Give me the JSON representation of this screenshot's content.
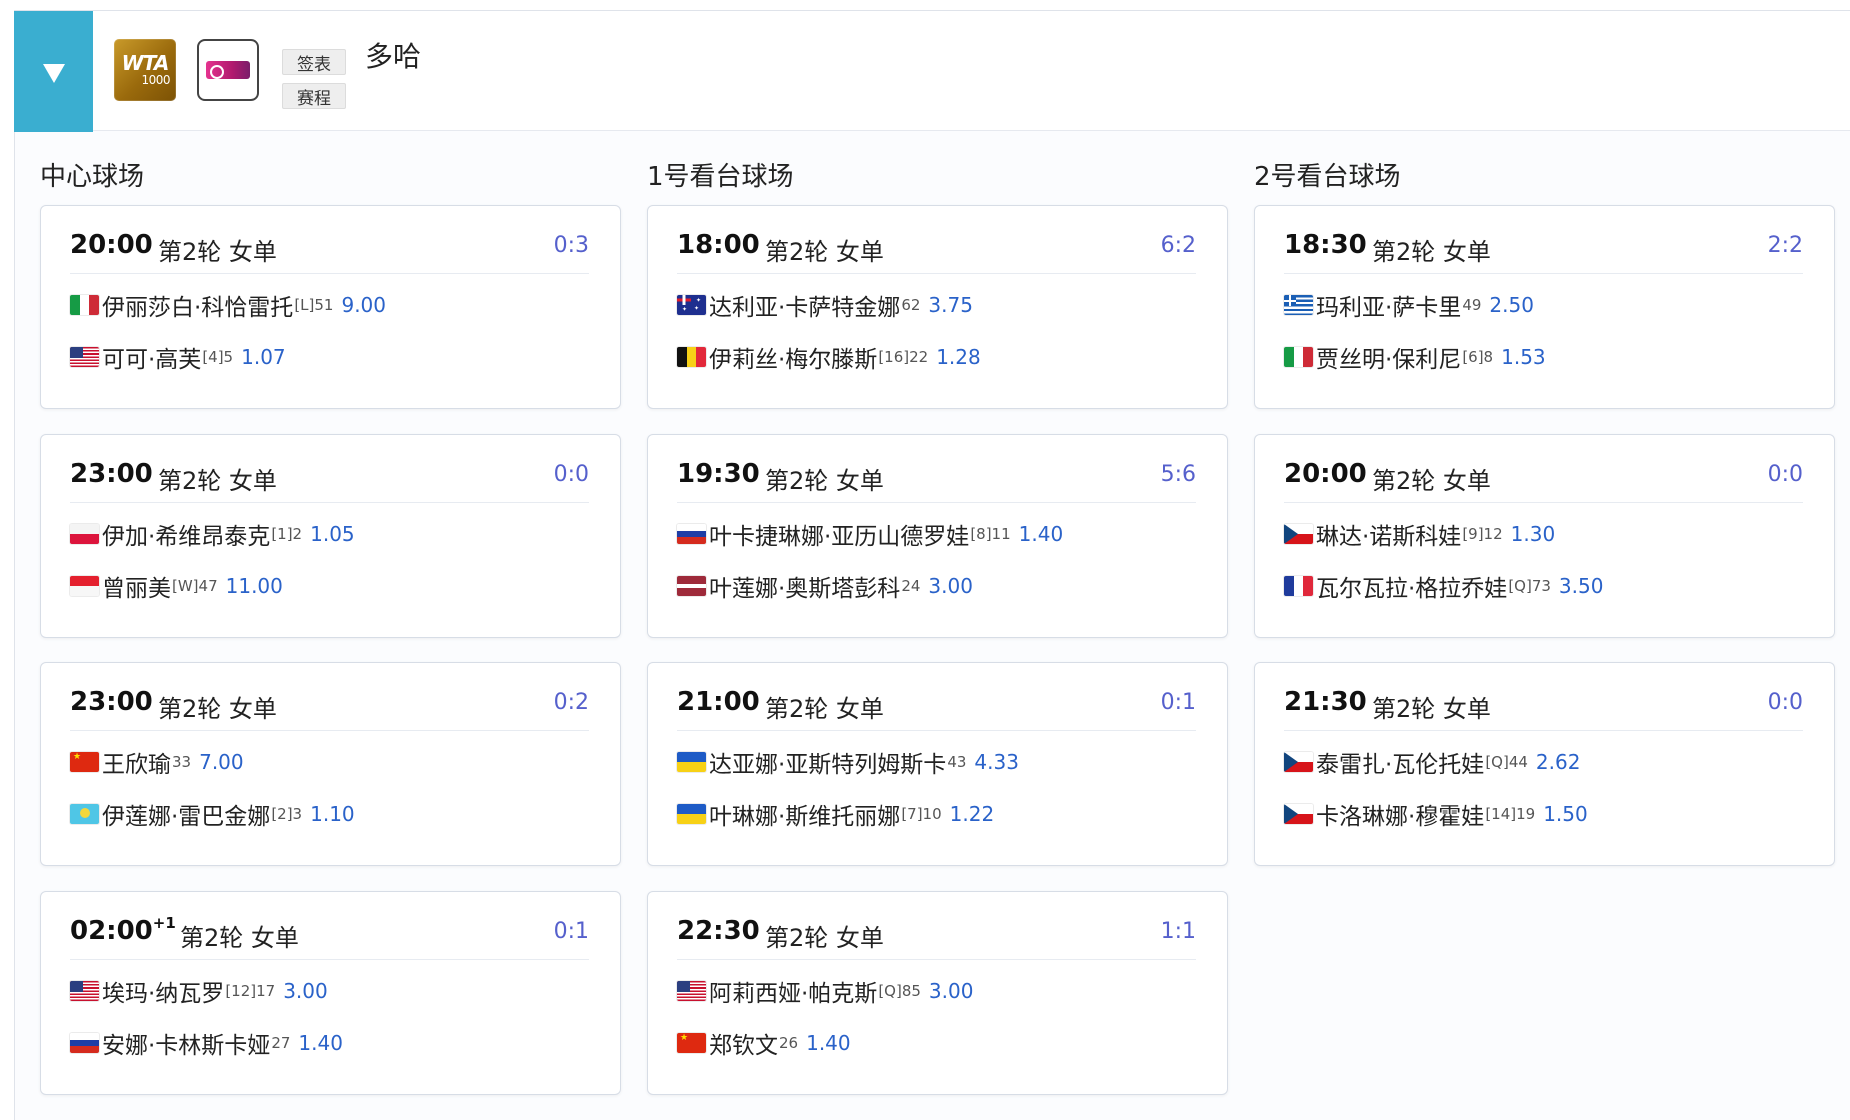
{
  "header": {
    "tournament": "多哈",
    "logo_text_main": "WTA",
    "logo_text_sub": "1000",
    "buttons": {
      "draw": "签表",
      "schedule": "赛程"
    }
  },
  "courts": [
    {
      "name": "中心球场"
    },
    {
      "name": "1号看台球场"
    },
    {
      "name": "2号看台球场"
    }
  ],
  "matches": {
    "center": [
      {
        "time": "20:00",
        "day_offset": "",
        "round": "第2轮 女单",
        "score": "0:3",
        "p1": {
          "flag": "italy",
          "name": "伊丽莎白·科恰雷托",
          "seed": "[L]51",
          "odds": "9.00"
        },
        "p2": {
          "flag": "usa",
          "name": "可可·高芙",
          "seed": "[4]5",
          "odds": "1.07"
        }
      },
      {
        "time": "23:00",
        "day_offset": "",
        "round": "第2轮 女单",
        "score": "0:0",
        "p1": {
          "flag": "poland",
          "name": "伊加·希维昂泰克",
          "seed": "[1]2",
          "odds": "1.05"
        },
        "p2": {
          "flag": "indonesia",
          "name": "曾丽美",
          "seed": "[W]47",
          "odds": "11.00"
        }
      },
      {
        "time": "23:00",
        "day_offset": "",
        "round": "第2轮 女单",
        "score": "0:2",
        "p1": {
          "flag": "china",
          "name": "王欣瑜",
          "seed": "33",
          "odds": "7.00"
        },
        "p2": {
          "flag": "kazakhstan",
          "name": "伊莲娜·雷巴金娜",
          "seed": "[2]3",
          "odds": "1.10"
        }
      },
      {
        "time": "02:00",
        "day_offset": "+1",
        "round": "第2轮 女单",
        "score": "0:1",
        "p1": {
          "flag": "usa",
          "name": "埃玛·纳瓦罗",
          "seed": "[12]17",
          "odds": "3.00"
        },
        "p2": {
          "flag": "russia",
          "name": "安娜·卡林斯卡娅",
          "seed": "27",
          "odds": "1.40"
        }
      }
    ],
    "court1": [
      {
        "time": "18:00",
        "day_offset": "",
        "round": "第2轮 女单",
        "score": "6:2",
        "p1": {
          "flag": "australia",
          "name": "达利亚·卡萨特金娜",
          "seed": "62",
          "odds": "3.75"
        },
        "p2": {
          "flag": "belgium",
          "name": "伊莉丝·梅尔滕斯",
          "seed": "[16]22",
          "odds": "1.28"
        }
      },
      {
        "time": "19:30",
        "day_offset": "",
        "round": "第2轮 女单",
        "score": "5:6",
        "p1": {
          "flag": "russia",
          "name": "叶卡捷琳娜·亚历山德罗娃",
          "seed": "[8]11",
          "odds": "1.40"
        },
        "p2": {
          "flag": "latvia",
          "name": "叶莲娜·奥斯塔彭科",
          "seed": "24",
          "odds": "3.00"
        }
      },
      {
        "time": "21:00",
        "day_offset": "",
        "round": "第2轮 女单",
        "score": "0:1",
        "p1": {
          "flag": "ukraine",
          "name": "达亚娜·亚斯特列姆斯卡",
          "seed": "43",
          "odds": "4.33"
        },
        "p2": {
          "flag": "ukraine",
          "name": "叶琳娜·斯维托丽娜",
          "seed": "[7]10",
          "odds": "1.22"
        }
      },
      {
        "time": "22:30",
        "day_offset": "",
        "round": "第2轮 女单",
        "score": "1:1",
        "p1": {
          "flag": "usa",
          "name": "阿莉西娅·帕克斯",
          "seed": "[Q]85",
          "odds": "3.00"
        },
        "p2": {
          "flag": "china",
          "name": "郑钦文",
          "seed": "26",
          "odds": "1.40"
        }
      }
    ],
    "court2": [
      {
        "time": "18:30",
        "day_offset": "",
        "round": "第2轮 女单",
        "score": "2:2",
        "p1": {
          "flag": "greece",
          "name": "玛利亚·萨卡里",
          "seed": "49",
          "odds": "2.50"
        },
        "p2": {
          "flag": "italy",
          "name": "贾丝明·保利尼",
          "seed": "[6]8",
          "odds": "1.53"
        }
      },
      {
        "time": "20:00",
        "day_offset": "",
        "round": "第2轮 女单",
        "score": "0:0",
        "p1": {
          "flag": "czech",
          "name": "琳达·诺斯科娃",
          "seed": "[9]12",
          "odds": "1.30"
        },
        "p2": {
          "flag": "france",
          "name": "瓦尔瓦拉·格拉乔娃",
          "seed": "[Q]73",
          "odds": "3.50"
        }
      },
      {
        "time": "21:30",
        "day_offset": "",
        "round": "第2轮 女单",
        "score": "0:0",
        "p1": {
          "flag": "czech",
          "name": "泰雷扎·瓦伦托娃",
          "seed": "[Q]44",
          "odds": "2.62"
        },
        "p2": {
          "flag": "czech",
          "name": "卡洛琳娜·穆霍娃",
          "seed": "[14]19",
          "odds": "1.50"
        }
      }
    ]
  },
  "colors": {
    "accent": "#3aaed0",
    "score": "#5560cc",
    "odds": "#2a62c9"
  }
}
